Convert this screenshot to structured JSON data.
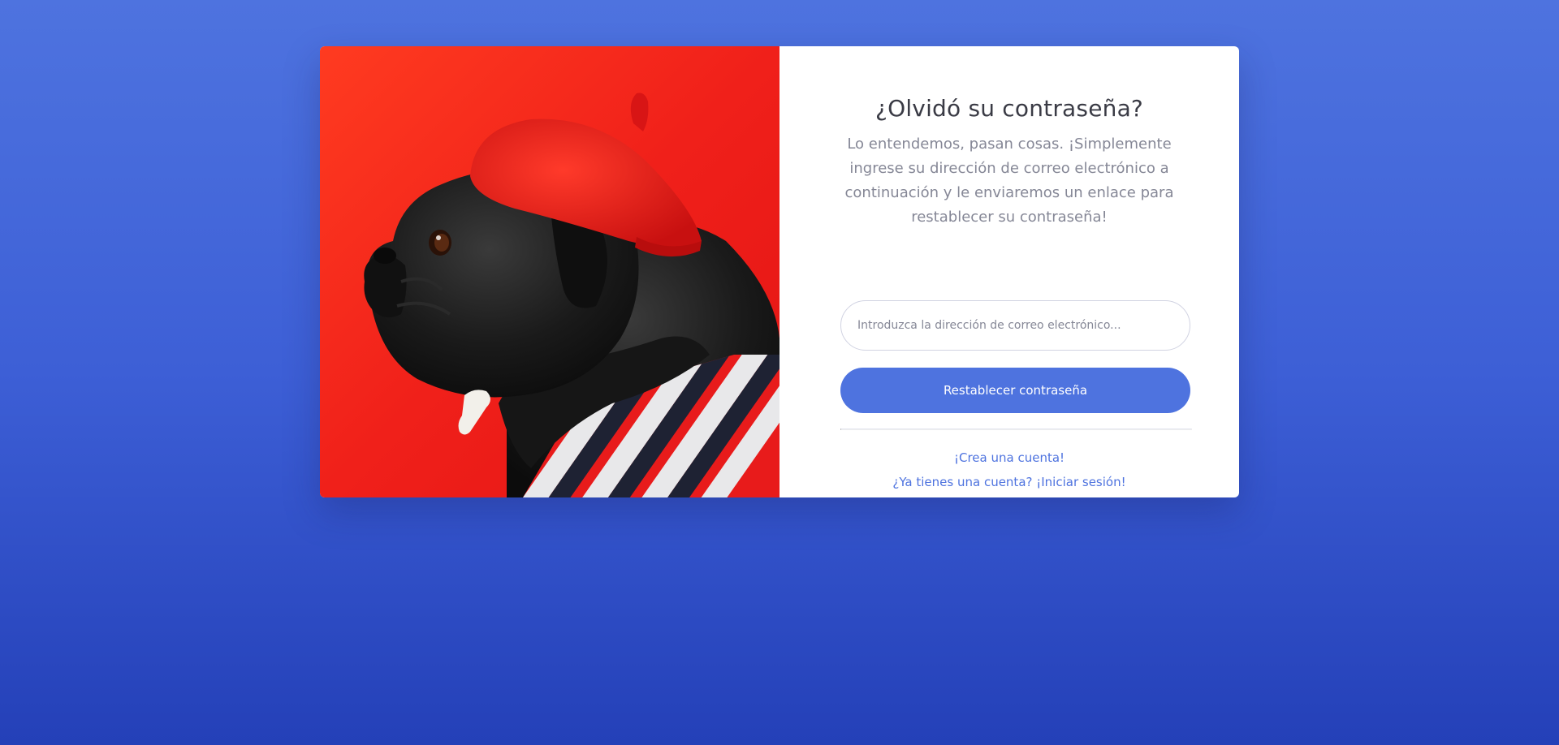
{
  "hero_image": {
    "subject": "pug wearing red beret and striped shirt on red background",
    "background_color": "#f0201a"
  },
  "form": {
    "title": "¿Olvidó su contraseña?",
    "subtitle": "Lo entendemos, pasan cosas. ¡Simplemente ingrese su dirección de correo electrónico a continuación y le enviaremos un enlace para restablecer su contraseña!",
    "email_placeholder": "Introduzca la dirección de correo electrónico...",
    "email_value": "",
    "submit_label": "Restablecer contraseña"
  },
  "links": {
    "create_account": "¡Crea una cuenta!",
    "login": "¿Ya tienes una cuenta? ¡Iniciar sesión!"
  },
  "colors": {
    "background_top": "#4e73df",
    "background_bottom": "#2440b8",
    "primary": "#4e73df",
    "title": "#3a3b45",
    "muted_text": "#858796"
  }
}
